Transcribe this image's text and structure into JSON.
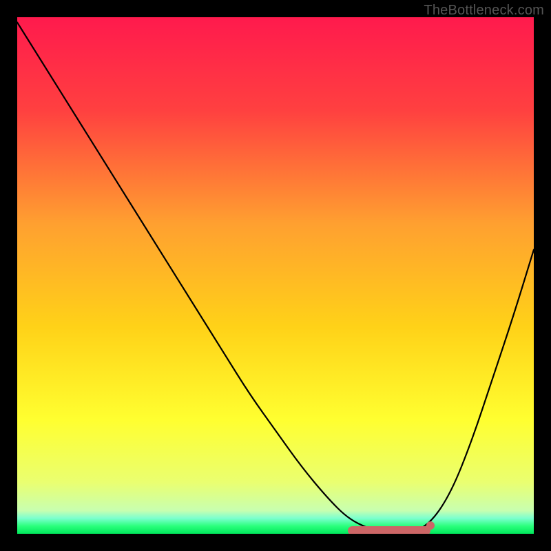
{
  "watermark": "TheBottleneck.com",
  "colors": {
    "frame": "#000000",
    "curve": "#000000",
    "knee": "#cc6666",
    "gradient_stops": [
      {
        "offset": 0.0,
        "color": "#ff1a4d"
      },
      {
        "offset": 0.18,
        "color": "#ff4040"
      },
      {
        "offset": 0.4,
        "color": "#ffa030"
      },
      {
        "offset": 0.6,
        "color": "#ffd218"
      },
      {
        "offset": 0.78,
        "color": "#ffff30"
      },
      {
        "offset": 0.9,
        "color": "#eaff70"
      },
      {
        "offset": 0.955,
        "color": "#c8ffb0"
      },
      {
        "offset": 0.97,
        "color": "#7bffcf"
      },
      {
        "offset": 0.985,
        "color": "#2bff7c"
      },
      {
        "offset": 1.0,
        "color": "#00e85c"
      }
    ]
  },
  "chart_data": {
    "type": "line",
    "title": "",
    "xlabel": "",
    "ylabel": "",
    "xlim": [
      0,
      100
    ],
    "ylim": [
      0,
      100
    ],
    "series": [
      {
        "name": "bottleneck-curve",
        "x": [
          0,
          5,
          10,
          15,
          20,
          25,
          30,
          35,
          40,
          45,
          50,
          55,
          60,
          64,
          68,
          72,
          76,
          80,
          84,
          88,
          92,
          96,
          100
        ],
        "values": [
          99,
          91,
          83,
          75,
          67,
          59,
          51,
          43,
          35,
          27,
          20,
          13,
          7,
          3,
          1,
          0,
          0,
          2,
          8,
          18,
          30,
          42,
          55
        ]
      }
    ],
    "annotations": [
      {
        "name": "sweet-spot-band",
        "x_start": 64,
        "x_end": 80,
        "y": 0
      },
      {
        "name": "sweet-spot-dot",
        "x": 80,
        "y": 1
      }
    ]
  }
}
